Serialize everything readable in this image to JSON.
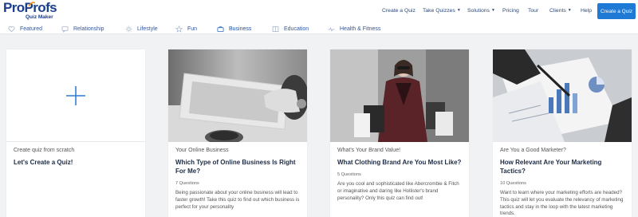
{
  "header": {
    "logo": {
      "brand_a": "Pro",
      "brand_b": "Profs",
      "sub": "Quiz Maker"
    },
    "nav": [
      {
        "label": "Create a Quiz",
        "dropdown": false
      },
      {
        "label": "Take Quizzes",
        "dropdown": true
      },
      {
        "label": "Solutions",
        "dropdown": true
      },
      {
        "label": "Pricing",
        "dropdown": false
      },
      {
        "label": "Tour",
        "dropdown": false
      },
      {
        "label": "Clients",
        "dropdown": true
      },
      {
        "label": "Help",
        "dropdown": false
      }
    ],
    "cta_label": "Create a Quiz"
  },
  "tabs": [
    {
      "label": "Featured",
      "icon": "heart-icon",
      "active": false
    },
    {
      "label": "Relationship",
      "icon": "chat-icon",
      "active": false
    },
    {
      "label": "Lifestyle",
      "icon": "sun-icon",
      "active": false
    },
    {
      "label": "Fun",
      "icon": "star-icon",
      "active": false
    },
    {
      "label": "Business",
      "icon": "briefcase-icon",
      "active": true
    },
    {
      "label": "Education",
      "icon": "book-icon",
      "active": false
    },
    {
      "label": "Health & Fitness",
      "icon": "heartbeat-icon",
      "active": false
    }
  ],
  "cards": {
    "create": {
      "kicker": "Create quiz from scratch",
      "title": "Let's Create a Quiz!",
      "icon": "plus-icon"
    },
    "quiz1": {
      "kicker": "Your Online Business",
      "title": "Which Type of Online Business Is Right For Me?",
      "count": "7 Questions",
      "desc": "Being passionate about your online business will lead to faster growth! Take this quiz to find out which business is perfect for your personality"
    },
    "quiz2": {
      "kicker": "What's Your Brand Value!",
      "title": "What Clothing Brand Are You Most Like?",
      "count": "5 Questions",
      "desc": "Are you cool and sophisticated like Abercrombie & Fitch or imaginative and daring like Hollister's brand personality? Only this quiz can find out!"
    },
    "quiz3": {
      "kicker": "Are You a Good Marketer?",
      "title": "How Relevant Are Your Marketing Tactics?",
      "count": "10 Questions",
      "desc": "Want to learn where your marketing efforts are headed? This quiz will let you evaluate the relevancy of marketing tactics and stay in the loop with the latest marketing trends."
    }
  },
  "colors": {
    "accent": "#1f7ad6",
    "nav_text": "#2c4a7c",
    "tab_text": "#2f57a0",
    "brand_orange": "#f7941d"
  }
}
